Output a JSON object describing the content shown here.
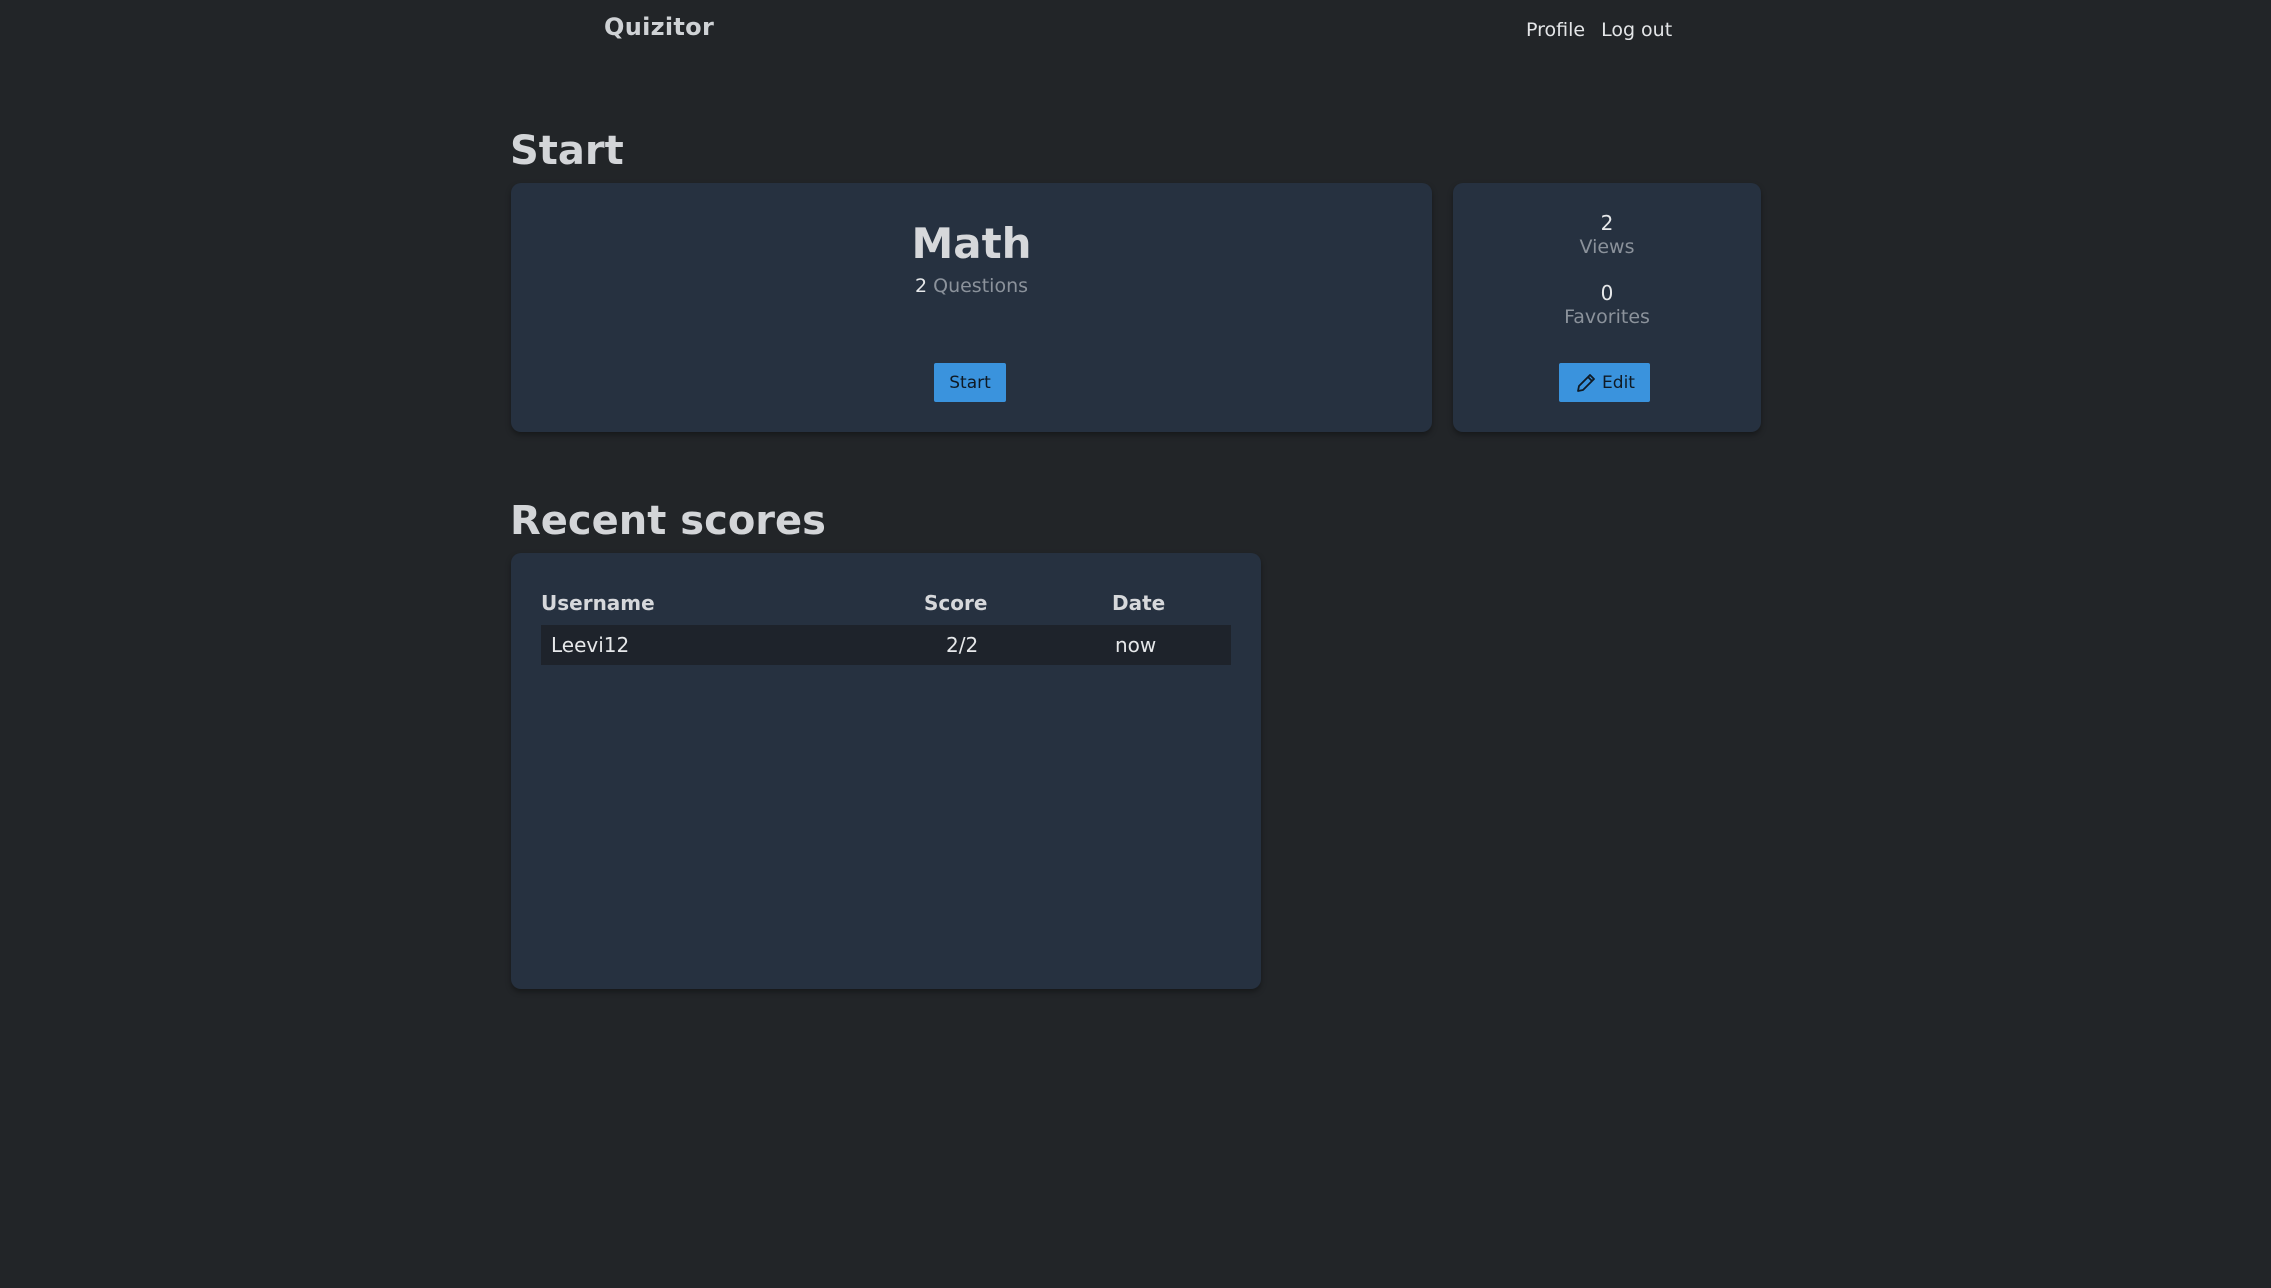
{
  "navbar": {
    "brand": "Quizitor",
    "links": {
      "profile": "Profile",
      "logout": "Log out"
    }
  },
  "start_section": {
    "title": "Start",
    "quiz": {
      "name": "Math",
      "question_count": "2",
      "questions_label": "Questions",
      "start_button": "Start"
    },
    "stats": {
      "views_value": "2",
      "views_label": "Views",
      "favorites_value": "0",
      "favorites_label": "Favorites",
      "edit_button": "Edit",
      "edit_icon": "pencil-icon"
    }
  },
  "recent_scores": {
    "title": "Recent scores",
    "columns": {
      "username": "Username",
      "score": "Score",
      "date": "Date"
    },
    "rows": [
      {
        "username": "Leevi12",
        "score": "2/2",
        "date": "now"
      }
    ]
  },
  "colors": {
    "background": "#222528",
    "card": "#263140",
    "accent": "#3a93dd",
    "row": "#1e232b"
  }
}
